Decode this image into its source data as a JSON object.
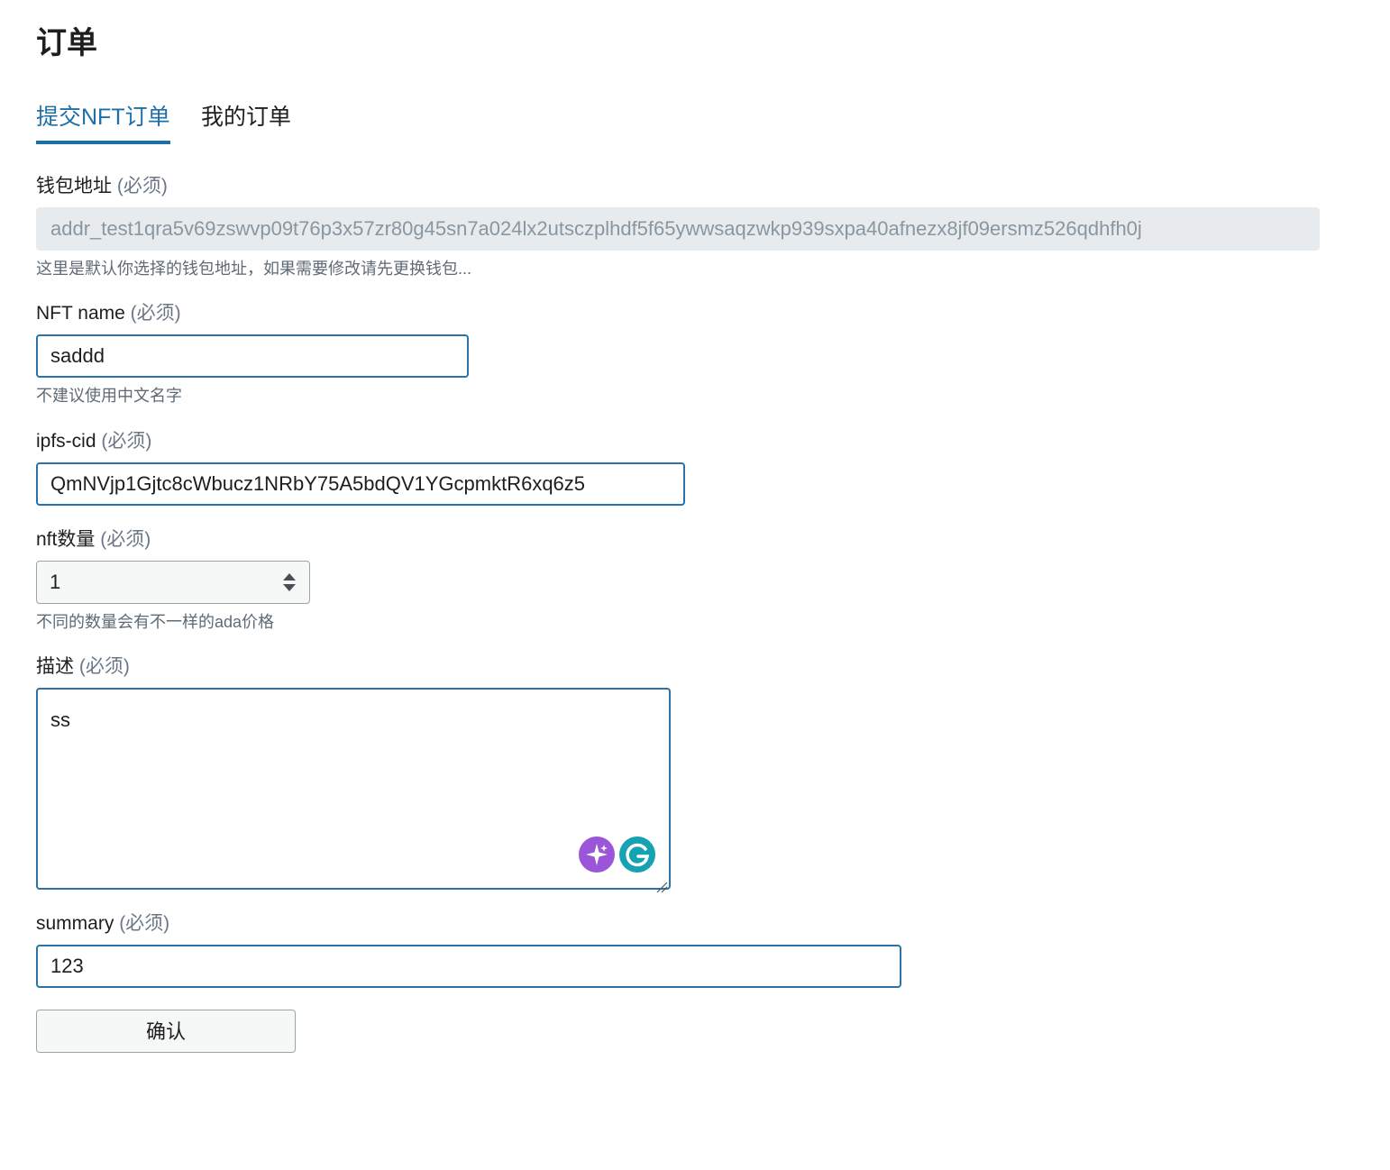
{
  "page": {
    "title": "订单"
  },
  "tabs": [
    {
      "label": "提交NFT订单",
      "active": true
    },
    {
      "label": "我的订单",
      "active": false
    }
  ],
  "form": {
    "required_suffix": "(必须)",
    "wallet": {
      "label": "钱包地址",
      "value": "addr_test1qra5v69zswvp09t76p3x57zr80g45sn7a024lx2utsczplhdf5f65ywwsaqzwkp939sxpa40afnezx8jf09ersmz526qdhfh0j",
      "help": "这里是默认你选择的钱包地址，如果需要修改请先更换钱包..."
    },
    "nft_name": {
      "label": "NFT name",
      "value": "saddd",
      "help": "不建议使用中文名字"
    },
    "ipfs_cid": {
      "label": "ipfs-cid",
      "value": "QmNVjp1Gjtc8cWbucz1NRbY75A5bdQV1YGcpmktR6xq6z5"
    },
    "nft_quantity": {
      "label": "nft数量",
      "value": "1",
      "help": "不同的数量会有不一样的ada价格"
    },
    "description": {
      "label": "描述",
      "value": "ss"
    },
    "summary": {
      "label": "summary",
      "value": "123"
    },
    "confirm_label": "确认"
  },
  "colors": {
    "accent": "#1e6fa8",
    "input_border": "#2a73a8",
    "ai_icon": "#9a55d8",
    "grammarly_icon": "#15a2b3"
  },
  "icons": [
    "sparkle-icon",
    "grammarly-icon",
    "spinner-icon",
    "resize-handle-icon"
  ]
}
